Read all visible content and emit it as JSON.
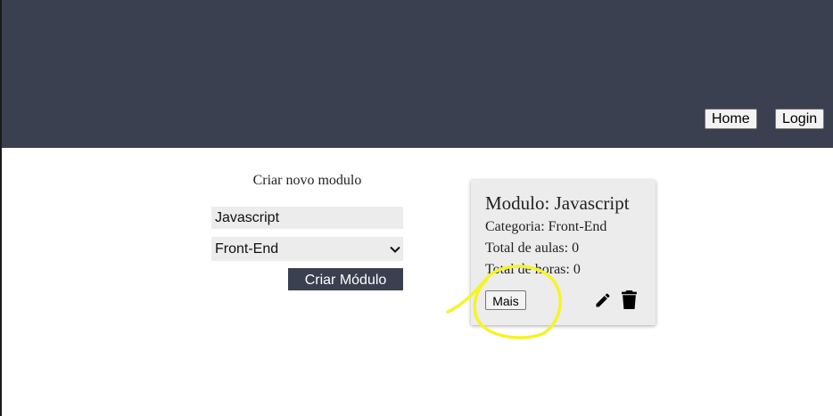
{
  "header": {
    "nav": {
      "home_label": "Home",
      "login_label": "Login"
    }
  },
  "form": {
    "title": "Criar novo modulo",
    "name_value": "Javascript",
    "category_selected": "Front-End",
    "submit_label": "Criar Módulo"
  },
  "card": {
    "title": "Modulo: Javascript",
    "category_line": "Categoria: Front-End",
    "aulas_line": "Total de aulas: 0",
    "horas_line": "Total de horas: 0",
    "more_label": "Mais",
    "icons": [
      "edit-icon",
      "delete-icon"
    ]
  },
  "colors": {
    "header_bg": "#3a4050",
    "button_bg": "#3a4050",
    "card_bg": "#ececec",
    "annotation": "#f4f42a"
  }
}
